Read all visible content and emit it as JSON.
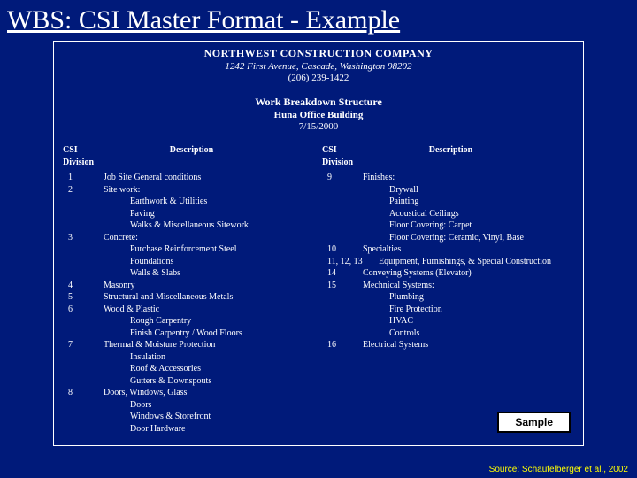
{
  "title": "WBS: CSI Master Format - Example",
  "header": {
    "company": "NORTHWEST CONSTRUCTION COMPANY",
    "address": "1242 First Avenue, Cascade, Washington 98202",
    "phone": "(206) 239-1422",
    "doc_title": "Work Breakdown Structure",
    "project": "Huna Office Building",
    "date": "7/15/2000"
  },
  "table_headers": {
    "division": "CSI Division",
    "description": "Description"
  },
  "left": [
    {
      "num": "1",
      "desc": "Job Site General conditions"
    },
    {
      "num": "2",
      "desc": "Site work:"
    },
    {
      "num": "",
      "desc": "Earthwork & Utilities",
      "sub": true
    },
    {
      "num": "",
      "desc": "Paving",
      "sub": true
    },
    {
      "num": "",
      "desc": "Walks & Miscellaneous Sitework",
      "sub": true
    },
    {
      "num": "3",
      "desc": "Concrete:"
    },
    {
      "num": "",
      "desc": "Purchase Reinforcement Steel",
      "sub": true
    },
    {
      "num": "",
      "desc": "Foundations",
      "sub": true
    },
    {
      "num": "",
      "desc": "Walls & Slabs",
      "sub": true
    },
    {
      "num": "4",
      "desc": "Masonry"
    },
    {
      "num": "5",
      "desc": "Structural and Miscellaneous Metals"
    },
    {
      "num": "6",
      "desc": "Wood & Plastic"
    },
    {
      "num": "",
      "desc": "Rough Carpentry",
      "sub": true
    },
    {
      "num": "",
      "desc": "Finish Carpentry / Wood Floors",
      "sub": true
    },
    {
      "num": "7",
      "desc": "Thermal & Moisture Protection"
    },
    {
      "num": "",
      "desc": "Insulation",
      "sub": true
    },
    {
      "num": "",
      "desc": "Roof & Accessories",
      "sub": true
    },
    {
      "num": "",
      "desc": "Gutters & Downspouts",
      "sub": true
    },
    {
      "num": "8",
      "desc": "Doors, Windows, Glass"
    },
    {
      "num": "",
      "desc": "Doors",
      "sub": true
    },
    {
      "num": "",
      "desc": "Windows & Storefront",
      "sub": true
    },
    {
      "num": "",
      "desc": "Door Hardware",
      "sub": true
    }
  ],
  "right": [
    {
      "num": "9",
      "desc": "Finishes:"
    },
    {
      "num": "",
      "desc": "Drywall",
      "sub": true
    },
    {
      "num": "",
      "desc": "Painting",
      "sub": true
    },
    {
      "num": "",
      "desc": "Acoustical Ceilings",
      "sub": true
    },
    {
      "num": "",
      "desc": "Floor Covering: Carpet",
      "sub": true
    },
    {
      "num": "",
      "desc": "Floor Covering: Ceramic, Vinyl, Base",
      "sub": true
    },
    {
      "num": "10",
      "desc": "Specialties"
    },
    {
      "num": "11, 12, 13",
      "desc": "Equipment, Furnishings, & Special Construction"
    },
    {
      "num": "14",
      "desc": "Conveying Systems (Elevator)"
    },
    {
      "num": "15",
      "desc": "Mechnical Systems:"
    },
    {
      "num": "",
      "desc": "Plumbing",
      "sub": true
    },
    {
      "num": "",
      "desc": "Fire Protection",
      "sub": true
    },
    {
      "num": "",
      "desc": "HVAC",
      "sub": true
    },
    {
      "num": "",
      "desc": "Controls",
      "sub": true
    },
    {
      "num": "16",
      "desc": "Electrical Systems"
    }
  ],
  "sample_label": "Sample",
  "source": "Source: Schaufelberger et al., 2002"
}
